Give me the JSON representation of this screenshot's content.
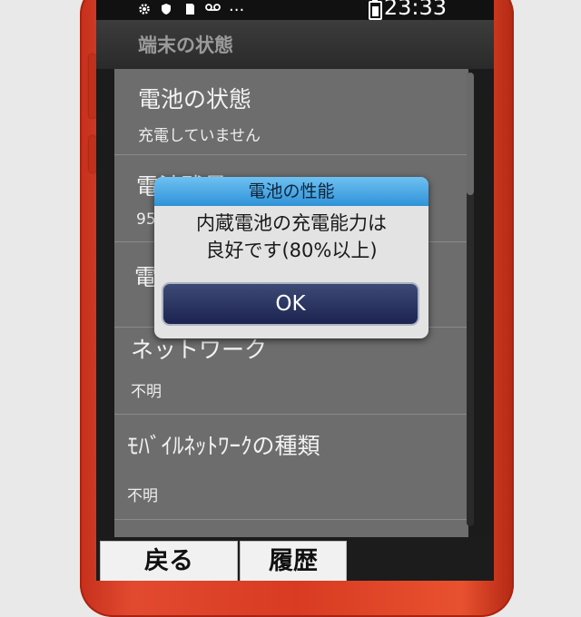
{
  "statusbar": {
    "time": "23:33",
    "icons": [
      "gear-icon",
      "shield-icon",
      "sd-card-icon",
      "voicemail-icon",
      "more-icon"
    ],
    "more_label": "..."
  },
  "header": {
    "title": "端末の状態"
  },
  "list": {
    "items": [
      {
        "label": "電池の状態",
        "value": "充電していません"
      },
      {
        "label": "電池残量",
        "value": "95"
      },
      {
        "label": "電",
        "value": ""
      },
      {
        "label": "ネットワーク",
        "value": "不明"
      },
      {
        "label": "ﾓﾊﾞｲﾙﾈｯﾄﾜｰｸの種類",
        "value": "不明"
      }
    ]
  },
  "dialog": {
    "title": "電池の性能",
    "line1": "内蔵電池の充電能力は",
    "line2": "良好です(80%以上)",
    "ok_label": "OK"
  },
  "softkeys": {
    "back_label": "戻る",
    "history_label": "履歴"
  },
  "colors": {
    "phone_red": "#d83b22",
    "dialog_title_blue": "#2f93d8",
    "ok_button_navy": "#1c2450"
  }
}
